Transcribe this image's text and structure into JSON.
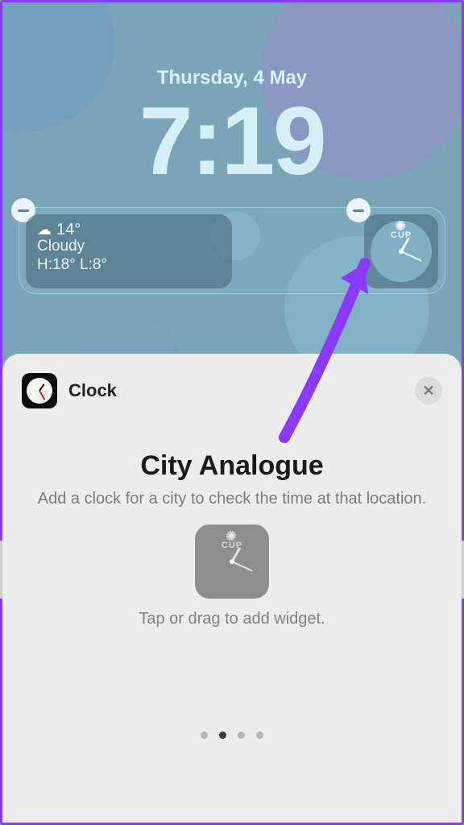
{
  "lockscreen": {
    "date": "Thursday, 4 May",
    "time": "7:19"
  },
  "weather": {
    "temp": "14°",
    "condition": "Cloudy",
    "hi_lo": "H:18° L:8°"
  },
  "clock_widget": {
    "city_code": "CUP"
  },
  "sheet": {
    "app_name": "Clock",
    "widget_title": "City Analogue",
    "widget_description": "Add a clock for a city to check the time at that location.",
    "preview_city_code": "CUP",
    "hint": "Tap or drag to add widget.",
    "page_count": 4,
    "active_page_index": 1
  }
}
